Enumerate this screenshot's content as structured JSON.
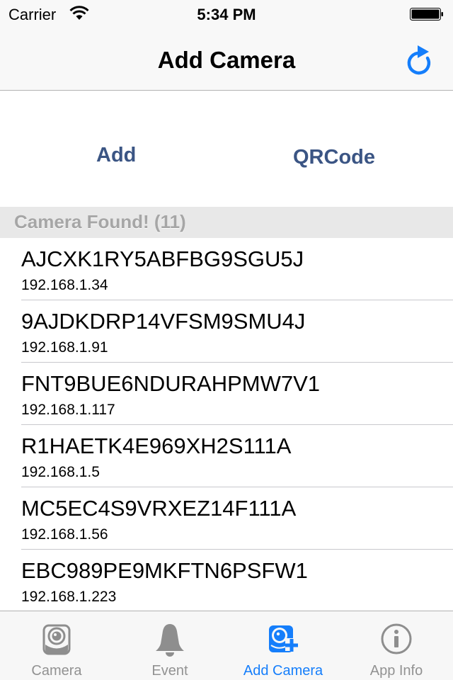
{
  "status_bar": {
    "carrier": "Carrier",
    "time": "5:34 PM",
    "wifi_icon": "wifi-icon",
    "battery_icon": "battery-full-icon"
  },
  "nav": {
    "title": "Add Camera",
    "refresh_icon": "refresh-icon"
  },
  "actions": {
    "add_label": "Add",
    "qrcode_label": "QRCode"
  },
  "section": {
    "header": "Camera Found! (11)",
    "count": 11
  },
  "cameras": [
    {
      "id": "AJCXK1RY5ABFBG9SGU5J",
      "ip": "192.168.1.34"
    },
    {
      "id": "9AJDKDRP14VFSM9SMU4J",
      "ip": "192.168.1.91"
    },
    {
      "id": "FNT9BUE6NDURAHPMW7V1",
      "ip": "192.168.1.117"
    },
    {
      "id": "R1HAETK4E969XH2S111A",
      "ip": "192.168.1.5"
    },
    {
      "id": "MC5EC4S9VRXEZ14F111A",
      "ip": "192.168.1.56"
    },
    {
      "id": "EBC989PE9MKFTN6PSFW1",
      "ip": "192.168.1.223"
    }
  ],
  "tabs": [
    {
      "label": "Camera",
      "icon": "camera-icon",
      "active": false
    },
    {
      "label": "Event",
      "icon": "bell-icon",
      "active": false
    },
    {
      "label": "Add Camera",
      "icon": "add-camera-icon",
      "active": true
    },
    {
      "label": "App Info",
      "icon": "info-icon",
      "active": false
    }
  ],
  "colors": {
    "accent": "#157efb",
    "action_text": "#3b5584",
    "inactive_tab": "#929292",
    "section_bg": "#e8e8e8",
    "section_text": "#a6a6a6"
  }
}
